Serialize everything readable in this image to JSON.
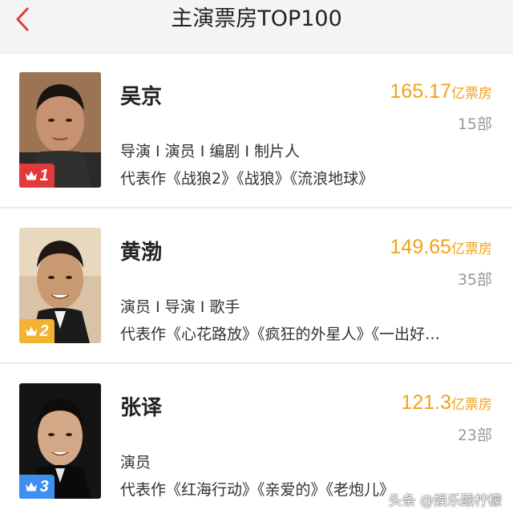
{
  "header": {
    "title": "主演票房TOP100"
  },
  "actors": [
    {
      "rank": "1",
      "name": "吴京",
      "box_office_value": "165.17",
      "box_office_unit": "亿票房",
      "films": "15部",
      "roles": "导演 I 演员 I 编剧 I 制片人",
      "works": "代表作《战狼2》《战狼》《流浪地球》",
      "badge_color": "#e23a3a"
    },
    {
      "rank": "2",
      "name": "黄渤",
      "box_office_value": "149.65",
      "box_office_unit": "亿票房",
      "films": "35部",
      "roles": "演员 I 导演 I 歌手",
      "works": "代表作《心花路放》《疯狂的外星人》《一出好…",
      "badge_color": "#f2b233"
    },
    {
      "rank": "3",
      "name": "张译",
      "box_office_value": "121.3",
      "box_office_unit": "亿票房",
      "films": "23部",
      "roles": "演员",
      "works": "代表作《红海行动》《亲爱的》《老炮儿》",
      "badge_color": "#3f8ef0"
    }
  ],
  "watermark": "头条 @娱乐酸柠檬"
}
